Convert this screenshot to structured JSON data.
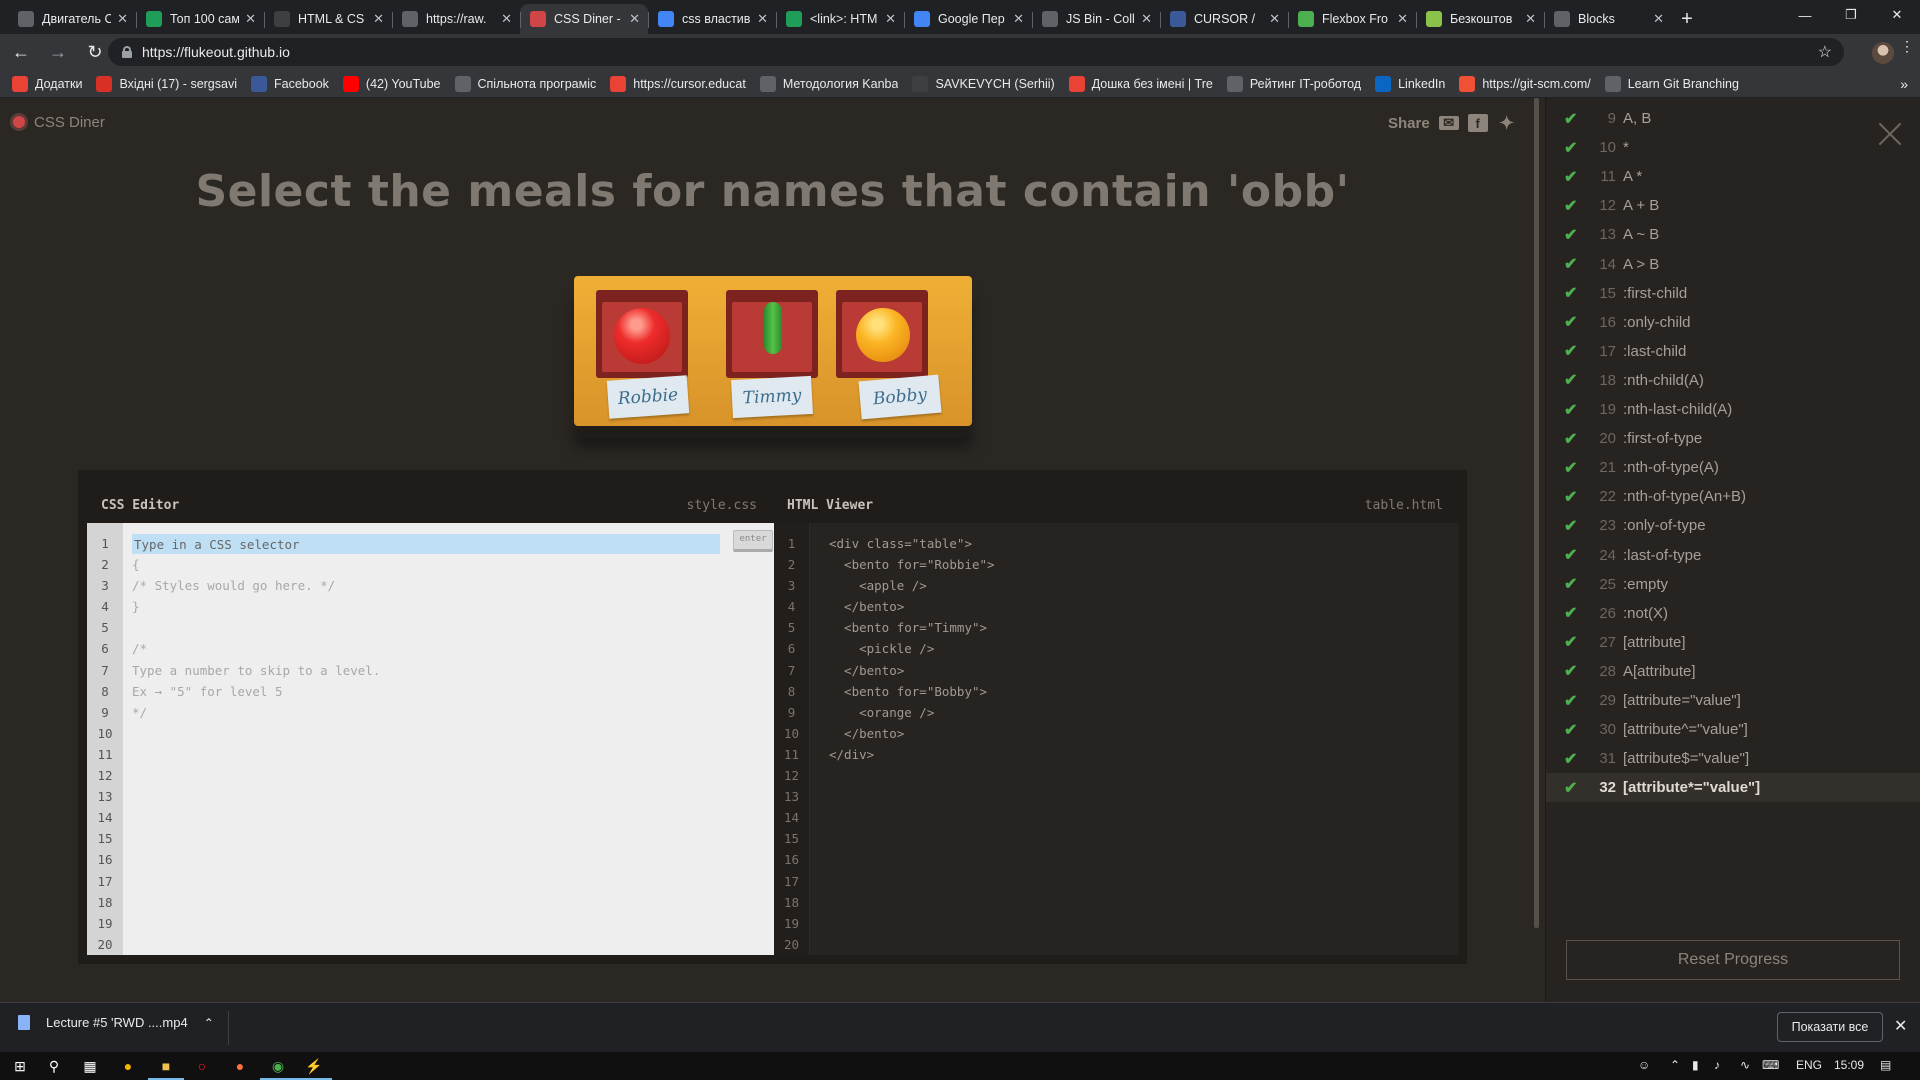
{
  "browser": {
    "tabs": [
      {
        "title": "Двигатель С",
        "color": "#5f6368"
      },
      {
        "title": "Топ 100 сам",
        "color": "#1e9e58"
      },
      {
        "title": "HTML & CS",
        "color": "#3c4043"
      },
      {
        "title": "https://raw.",
        "color": "#5f6368"
      },
      {
        "title": "CSS Diner -",
        "color": "#d04545"
      },
      {
        "title": "css властив",
        "color": "#4285f4"
      },
      {
        "title": "<link>: HTM",
        "color": "#1e9e58"
      },
      {
        "title": "Google Пер",
        "color": "#4285f4"
      },
      {
        "title": "JS Bin - Coll",
        "color": "#5f6368"
      },
      {
        "title": "CURSOR / ",
        "color": "#3b5998"
      },
      {
        "title": "Flexbox Fro",
        "color": "#4caf50"
      },
      {
        "title": "Безкоштов",
        "color": "#8bc34a"
      },
      {
        "title": "Blocks",
        "color": "#5f6368"
      }
    ],
    "new_tab_label": "+",
    "url": "https://flukeout.github.io",
    "bookmarks": [
      {
        "label": "Додатки",
        "color": "#ea4335"
      },
      {
        "label": "Вхідні (17) - sergsavi",
        "color": "#d93025"
      },
      {
        "label": "Facebook",
        "color": "#3b5998"
      },
      {
        "label": "(42) YouTube",
        "color": "#ff0000"
      },
      {
        "label": "Спільнота програміс",
        "color": "#5f6368"
      },
      {
        "label": "https://cursor.educat",
        "color": "#ea4335"
      },
      {
        "label": "Методология Kanba",
        "color": "#5f6368"
      },
      {
        "label": "SAVKEVYCH (Serhii)",
        "color": "#3c4043"
      },
      {
        "label": "Дошка без імені | Tre",
        "color": "#ea4335"
      },
      {
        "label": "Рейтинг IT-роботод",
        "color": "#5f6368"
      },
      {
        "label": "LinkedIn",
        "color": "#0a66c2"
      },
      {
        "label": "https://git-scm.com/",
        "color": "#f05033"
      },
      {
        "label": "Learn Git Branching",
        "color": "#5f6368"
      }
    ]
  },
  "app": {
    "logo_text": "CSS Diner",
    "share_label": "Share",
    "instruction": "Select the meals for names that contain 'obb'",
    "bentos": [
      {
        "food": "apple",
        "name": "Robbie"
      },
      {
        "food": "pickle",
        "name": "Timmy"
      },
      {
        "food": "orange",
        "name": "Bobby"
      }
    ],
    "css_editor": {
      "title": "CSS Editor",
      "filename": "style.css",
      "placeholder": "Type in a CSS selector",
      "enter_label": "enter",
      "lines": [
        "",
        "{",
        "/* Styles would go here. */",
        "}",
        "",
        "/*",
        "Type a number to skip to a level.",
        "Ex → \"5\" for level 5",
        "*/",
        "",
        "",
        "",
        "",
        "",
        "",
        "",
        "",
        "",
        "",
        ""
      ]
    },
    "html_viewer": {
      "title": "HTML Viewer",
      "filename": "table.html",
      "lines": [
        "<div class=\"table\">",
        "  <bento for=\"Robbie\">",
        "    <apple />",
        "  </bento>",
        "  <bento for=\"Timmy\">",
        "    <pickle />",
        "  </bento>",
        "  <bento for=\"Bobby\">",
        "    <orange />",
        "  </bento>",
        "</div>",
        "",
        "",
        "",
        "",
        "",
        "",
        "",
        "",
        ""
      ]
    },
    "line_numbers": [
      "1",
      "2",
      "3",
      "4",
      "5",
      "6",
      "7",
      "8",
      "9",
      "10",
      "11",
      "12",
      "13",
      "14",
      "15",
      "16",
      "17",
      "18",
      "19",
      "20"
    ],
    "levels": [
      {
        "num": "9",
        "name": "A, B"
      },
      {
        "num": "10",
        "name": "*"
      },
      {
        "num": "11",
        "name": "A *"
      },
      {
        "num": "12",
        "name": "A + B"
      },
      {
        "num": "13",
        "name": "A ~ B"
      },
      {
        "num": "14",
        "name": "A > B"
      },
      {
        "num": "15",
        "name": ":first-child"
      },
      {
        "num": "16",
        "name": ":only-child"
      },
      {
        "num": "17",
        "name": ":last-child"
      },
      {
        "num": "18",
        "name": ":nth-child(A)"
      },
      {
        "num": "19",
        "name": ":nth-last-child(A)"
      },
      {
        "num": "20",
        "name": ":first-of-type"
      },
      {
        "num": "21",
        "name": ":nth-of-type(A)"
      },
      {
        "num": "22",
        "name": ":nth-of-type(An+B)"
      },
      {
        "num": "23",
        "name": ":only-of-type"
      },
      {
        "num": "24",
        "name": ":last-of-type"
      },
      {
        "num": "25",
        "name": ":empty"
      },
      {
        "num": "26",
        "name": ":not(X)"
      },
      {
        "num": "27",
        "name": "[attribute]"
      },
      {
        "num": "28",
        "name": "A[attribute]"
      },
      {
        "num": "29",
        "name": "[attribute=\"value\"]"
      },
      {
        "num": "30",
        "name": "[attribute^=\"value\"]"
      },
      {
        "num": "31",
        "name": "[attribute$=\"value\"]"
      },
      {
        "num": "32",
        "name": "[attribute*=\"value\"]",
        "current": true
      }
    ],
    "reset_label": "Reset Progress"
  },
  "downloads": {
    "file_name": "Lecture #5 'RWD ....mp4",
    "show_all_label": "Показати все"
  },
  "taskbar": {
    "language": "ENG",
    "time": "15:09"
  }
}
